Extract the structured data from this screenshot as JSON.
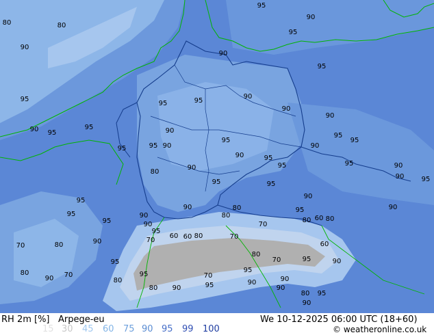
{
  "header": {
    "variable": "RH 2m [%]",
    "model": "Arpege-eu",
    "datetime": "We 10-12-2025 06:00 UTC (18+60)",
    "credit": "© weatheronline.co.uk"
  },
  "legend": {
    "values": [
      "15",
      "30",
      "45",
      "60",
      "75",
      "90",
      "95",
      "99",
      "100"
    ],
    "colors": [
      "#e1e1e1",
      "#c8c8c8",
      "#a0c8f0",
      "#82b4e6",
      "#6ea0dc",
      "#5a8cd2",
      "#466ec8",
      "#3250b4",
      "#1e3ca0"
    ]
  },
  "map": {
    "contour_labels": [
      "80",
      "80",
      "90",
      "95",
      "90",
      "95",
      "90",
      "95",
      "95",
      "95",
      "95",
      "90",
      "90",
      "90",
      "95",
      "95",
      "90",
      "90",
      "95",
      "90",
      "95",
      "95",
      "95",
      "95",
      "90",
      "90",
      "95",
      "95",
      "95",
      "90",
      "90",
      "95",
      "80",
      "90",
      "95",
      "95",
      "90",
      "95",
      "90",
      "80",
      "90",
      "95",
      "95",
      "90",
      "80",
      "95",
      "80",
      "60",
      "80",
      "70",
      "95",
      "90",
      "90",
      "70",
      "80",
      "70",
      "60",
      "60",
      "80",
      "70",
      "60",
      "80",
      "70",
      "95",
      "90",
      "95",
      "80",
      "90",
      "70",
      "80",
      "95",
      "70",
      "90",
      "95",
      "90",
      "90",
      "95",
      "80",
      "90",
      "80",
      "95",
      "90"
    ]
  }
}
